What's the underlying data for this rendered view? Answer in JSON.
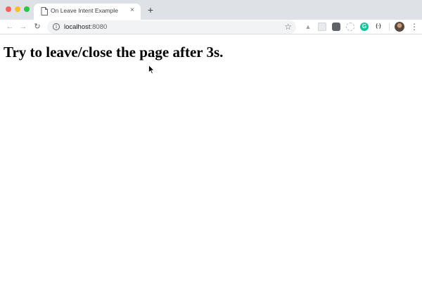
{
  "browser": {
    "tab": {
      "title": "On Leave Intent Example",
      "close_glyph": "×"
    },
    "new_tab_glyph": "+",
    "address_bar": {
      "host": "localhost",
      "port": ":8080"
    },
    "icons": {
      "back": "arrow-left-icon",
      "forward": "arrow-right-icon",
      "reload": "reload-icon",
      "info": "info-icon",
      "bookmark": "star-icon",
      "menu": "kebab-menu-icon"
    },
    "extensions": {
      "grammarly_label": "G",
      "json_label": "{∙}"
    }
  },
  "page": {
    "heading": "Try to leave/close the page after 3s."
  },
  "colors": {
    "tabstrip": "#dee1e6",
    "traffic_close": "#fe5f57",
    "traffic_min": "#febc2e",
    "traffic_max": "#28c840",
    "grammarly": "#15c39a"
  }
}
